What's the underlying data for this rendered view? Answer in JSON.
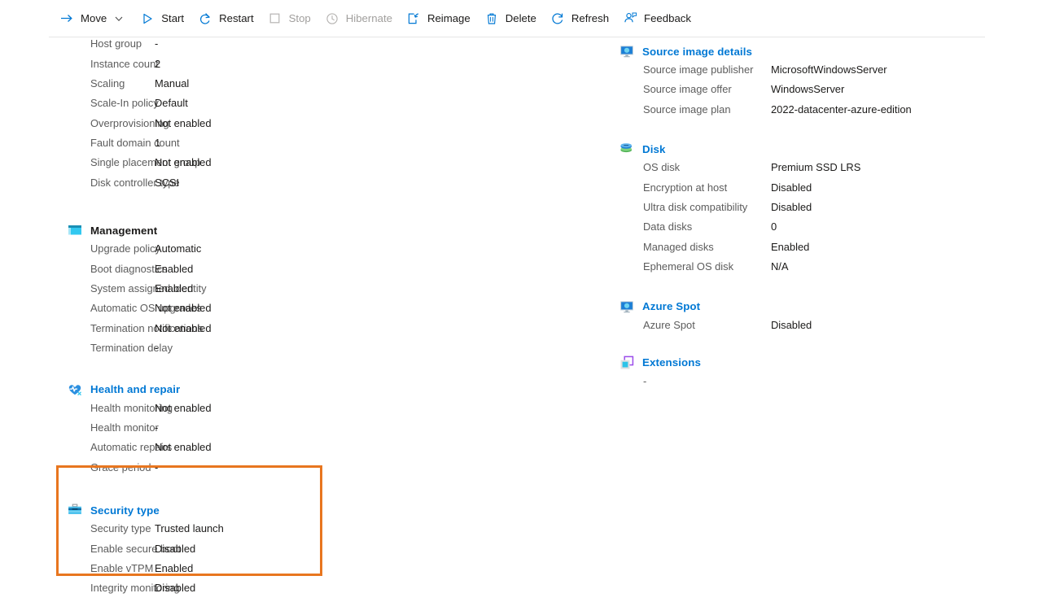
{
  "toolbar": {
    "items": [
      {
        "label": "Move",
        "icon": "move-arrow-icon",
        "disabled": false,
        "chevron": true
      },
      {
        "label": "Start",
        "icon": "play-icon",
        "disabled": false,
        "chevron": false
      },
      {
        "label": "Restart",
        "icon": "restart-icon",
        "disabled": false,
        "chevron": false
      },
      {
        "label": "Stop",
        "icon": "stop-square-icon",
        "disabled": true,
        "chevron": false
      },
      {
        "label": "Hibernate",
        "icon": "clock-icon",
        "disabled": true,
        "chevron": false
      },
      {
        "label": "Reimage",
        "icon": "reimage-icon",
        "disabled": false,
        "chevron": false
      },
      {
        "label": "Delete",
        "icon": "trash-icon",
        "disabled": false,
        "chevron": false
      },
      {
        "label": "Refresh",
        "icon": "refresh-icon",
        "disabled": false,
        "chevron": false
      },
      {
        "label": "Feedback",
        "icon": "feedback-person-icon",
        "disabled": false,
        "chevron": false
      }
    ]
  },
  "colors": {
    "accent_blue": "#0078d4",
    "highlight_orange": "#e8761f",
    "label_gray": "#5c5c5c",
    "value_black": "#1b1a19",
    "disabled_gray": "#a19f9d"
  },
  "left_column": {
    "top_rows": [
      {
        "key": "Host group",
        "value": "-"
      },
      {
        "key": "Instance count",
        "value": "2"
      },
      {
        "key": "Scaling",
        "value": "Manual"
      },
      {
        "key": "Scale-In policy",
        "value": "Default"
      },
      {
        "key": "Overprovisioning",
        "value": "Not enabled"
      },
      {
        "key": "Fault domain count",
        "value": "1"
      },
      {
        "key": "Single placement group",
        "value": "Not enabled"
      },
      {
        "key": "Disk controller type",
        "value": "SCSI"
      }
    ],
    "management": {
      "title": "Management",
      "icon": "management-monitor-icon",
      "rows": [
        {
          "key": "Upgrade policy",
          "value": "Automatic"
        },
        {
          "key": "Boot diagnostics",
          "value": "Enabled"
        },
        {
          "key": "System assigned identity",
          "value": "Enabled"
        },
        {
          "key": "Automatic OS upgrades",
          "value": "Not enabled"
        },
        {
          "key": "Termination notifications",
          "value": "Not enabled"
        },
        {
          "key": "Termination delay",
          "value": "-"
        }
      ]
    },
    "health_and_repair": {
      "title": "Health and repair",
      "icon": "heart-pulse-icon",
      "rows": [
        {
          "key": "Health monitoring",
          "value": "Not enabled"
        },
        {
          "key": "Health monitor",
          "value": "-"
        },
        {
          "key": "Automatic repairs",
          "value": "Not enabled"
        },
        {
          "key": "Grace period",
          "value": "-"
        }
      ]
    },
    "security_type": {
      "title": "Security type",
      "icon": "security-toolbox-icon",
      "highlighted": true,
      "rows": [
        {
          "key": "Security type",
          "value": "Trusted launch"
        },
        {
          "key": "Enable secure boot",
          "value": "Disabled"
        },
        {
          "key": "Enable vTPM",
          "value": "Enabled"
        },
        {
          "key": "Integrity monitoring",
          "value": "Disabled"
        }
      ]
    }
  },
  "right_column": {
    "source_image_details": {
      "title": "Source image details",
      "icon": "monitor-icon",
      "rows": [
        {
          "key": "Source image publisher",
          "value": "MicrosoftWindowsServer"
        },
        {
          "key": "Source image offer",
          "value": "WindowsServer"
        },
        {
          "key": "Source image plan",
          "value": "2022-datacenter-azure-edition"
        }
      ]
    },
    "disk": {
      "title": "Disk",
      "icon": "disk-stack-icon",
      "rows": [
        {
          "key": "OS disk",
          "value": "Premium SSD LRS"
        },
        {
          "key": "Encryption at host",
          "value": "Disabled"
        },
        {
          "key": "Ultra disk compatibility",
          "value": "Disabled"
        },
        {
          "key": "Data disks",
          "value": "0"
        },
        {
          "key": "Managed disks",
          "value": "Enabled"
        },
        {
          "key": "Ephemeral OS disk",
          "value": "N/A"
        }
      ]
    },
    "azure_spot": {
      "title": "Azure Spot",
      "icon": "monitor-icon",
      "rows": [
        {
          "key": "Azure Spot",
          "value": "Disabled"
        }
      ]
    },
    "extensions": {
      "title": "Extensions",
      "icon": "extensions-square-icon",
      "empty_value": "-"
    }
  }
}
